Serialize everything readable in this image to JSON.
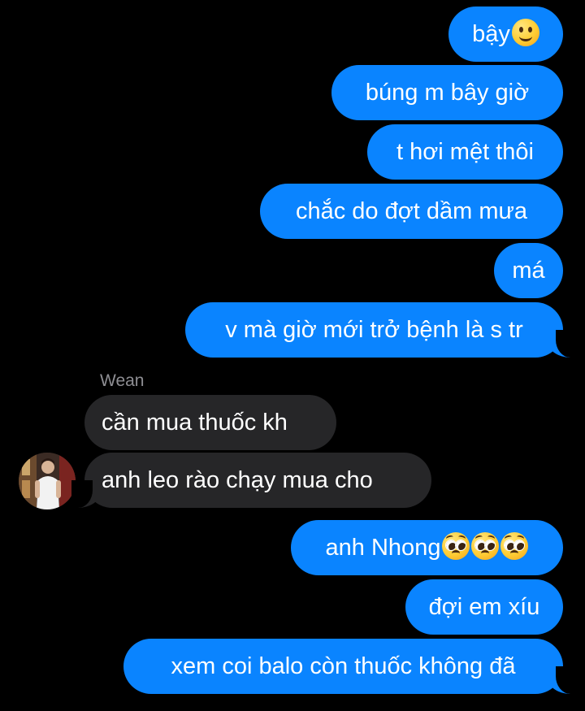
{
  "conversation": {
    "messages": [
      {
        "sender": "me",
        "text": "bậy",
        "emoji": "slightly-smiling-face-emoji"
      },
      {
        "sender": "me",
        "text": "búng m bây giờ"
      },
      {
        "sender": "me",
        "text": "t hơi mệt thôi"
      },
      {
        "sender": "me",
        "text": "chắc do đợt dầm mưa"
      },
      {
        "sender": "me",
        "text": "má"
      },
      {
        "sender": "me",
        "text": "v mà giờ mới trở bệnh là s tr"
      },
      {
        "sender": "contact",
        "sender_name": "Wean",
        "text": "cần mua thuốc kh"
      },
      {
        "sender": "contact",
        "text": "anh leo rào chạy mua cho"
      },
      {
        "sender": "me",
        "text": "anh Nhong",
        "emoji": "pleading-face-emoji x3"
      },
      {
        "sender": "me",
        "text": "đợi em xíu"
      },
      {
        "sender": "me",
        "text": "xem coi balo còn thuốc không đã"
      }
    ]
  },
  "colors": {
    "background": "#000000",
    "outgoing_bubble": "#0a84ff",
    "incoming_bubble": "#262628",
    "sender_name": "#8e8e93",
    "text": "#ffffff"
  }
}
